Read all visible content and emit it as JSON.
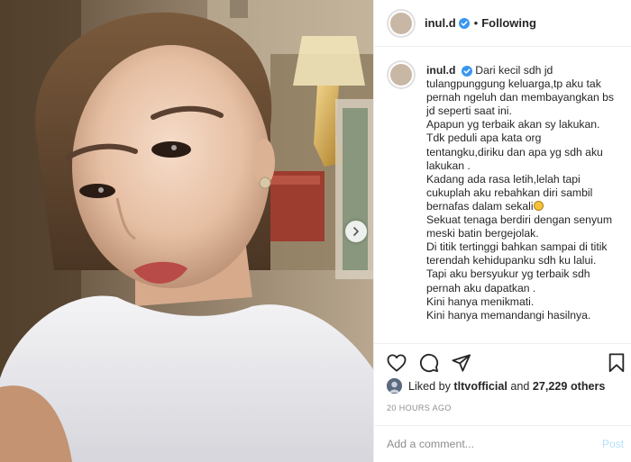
{
  "header": {
    "username": "inul.d",
    "separator": "•",
    "follow_status": "Following"
  },
  "caption": {
    "username": "inul.d",
    "first_line": "Dari kecil sdh jd",
    "lines": [
      "tulangpunggung keluarga,tp aku tak",
      "pernah ngeluh dan membayangkan bs",
      "jd seperti saat ini.",
      "Apapun yg terbaik akan sy lakukan.",
      "Tdk peduli apa kata org",
      "tentangku,diriku dan apa yg sdh aku",
      "lakukan .",
      "Kadang ada rasa letih,lelah tapi",
      "cukuplah aku rebahkan diri sambil",
      "bernafas dalam sekali",
      "Sekuat tenaga berdiri dengan senyum",
      "meski batin bergejolak.",
      "Di titik tertinggi bahkan sampai di titik",
      "terendah kehidupanku sdh ku lalui.",
      "Tapi aku bersyukur yg terbaik sdh",
      "pernah aku dapatkan .",
      "Kini hanya menikmati.",
      "Kini hanya memandangi hasilnya."
    ]
  },
  "actions": {
    "like_icon": "heart-icon",
    "comment_icon": "comment-icon",
    "share_icon": "paper-plane-icon",
    "save_icon": "bookmark-icon"
  },
  "likes": {
    "prefix": "Liked by",
    "user": "tltvofficial",
    "connector": "and",
    "others": "27,229 others"
  },
  "timestamp": "20 HOURS AGO",
  "comment_box": {
    "placeholder": "Add a comment...",
    "post_label": "Post"
  },
  "colors": {
    "verified_blue": "#3897f0",
    "post_disabled": "#b2dffc",
    "muted_text": "#8e8e8e"
  }
}
